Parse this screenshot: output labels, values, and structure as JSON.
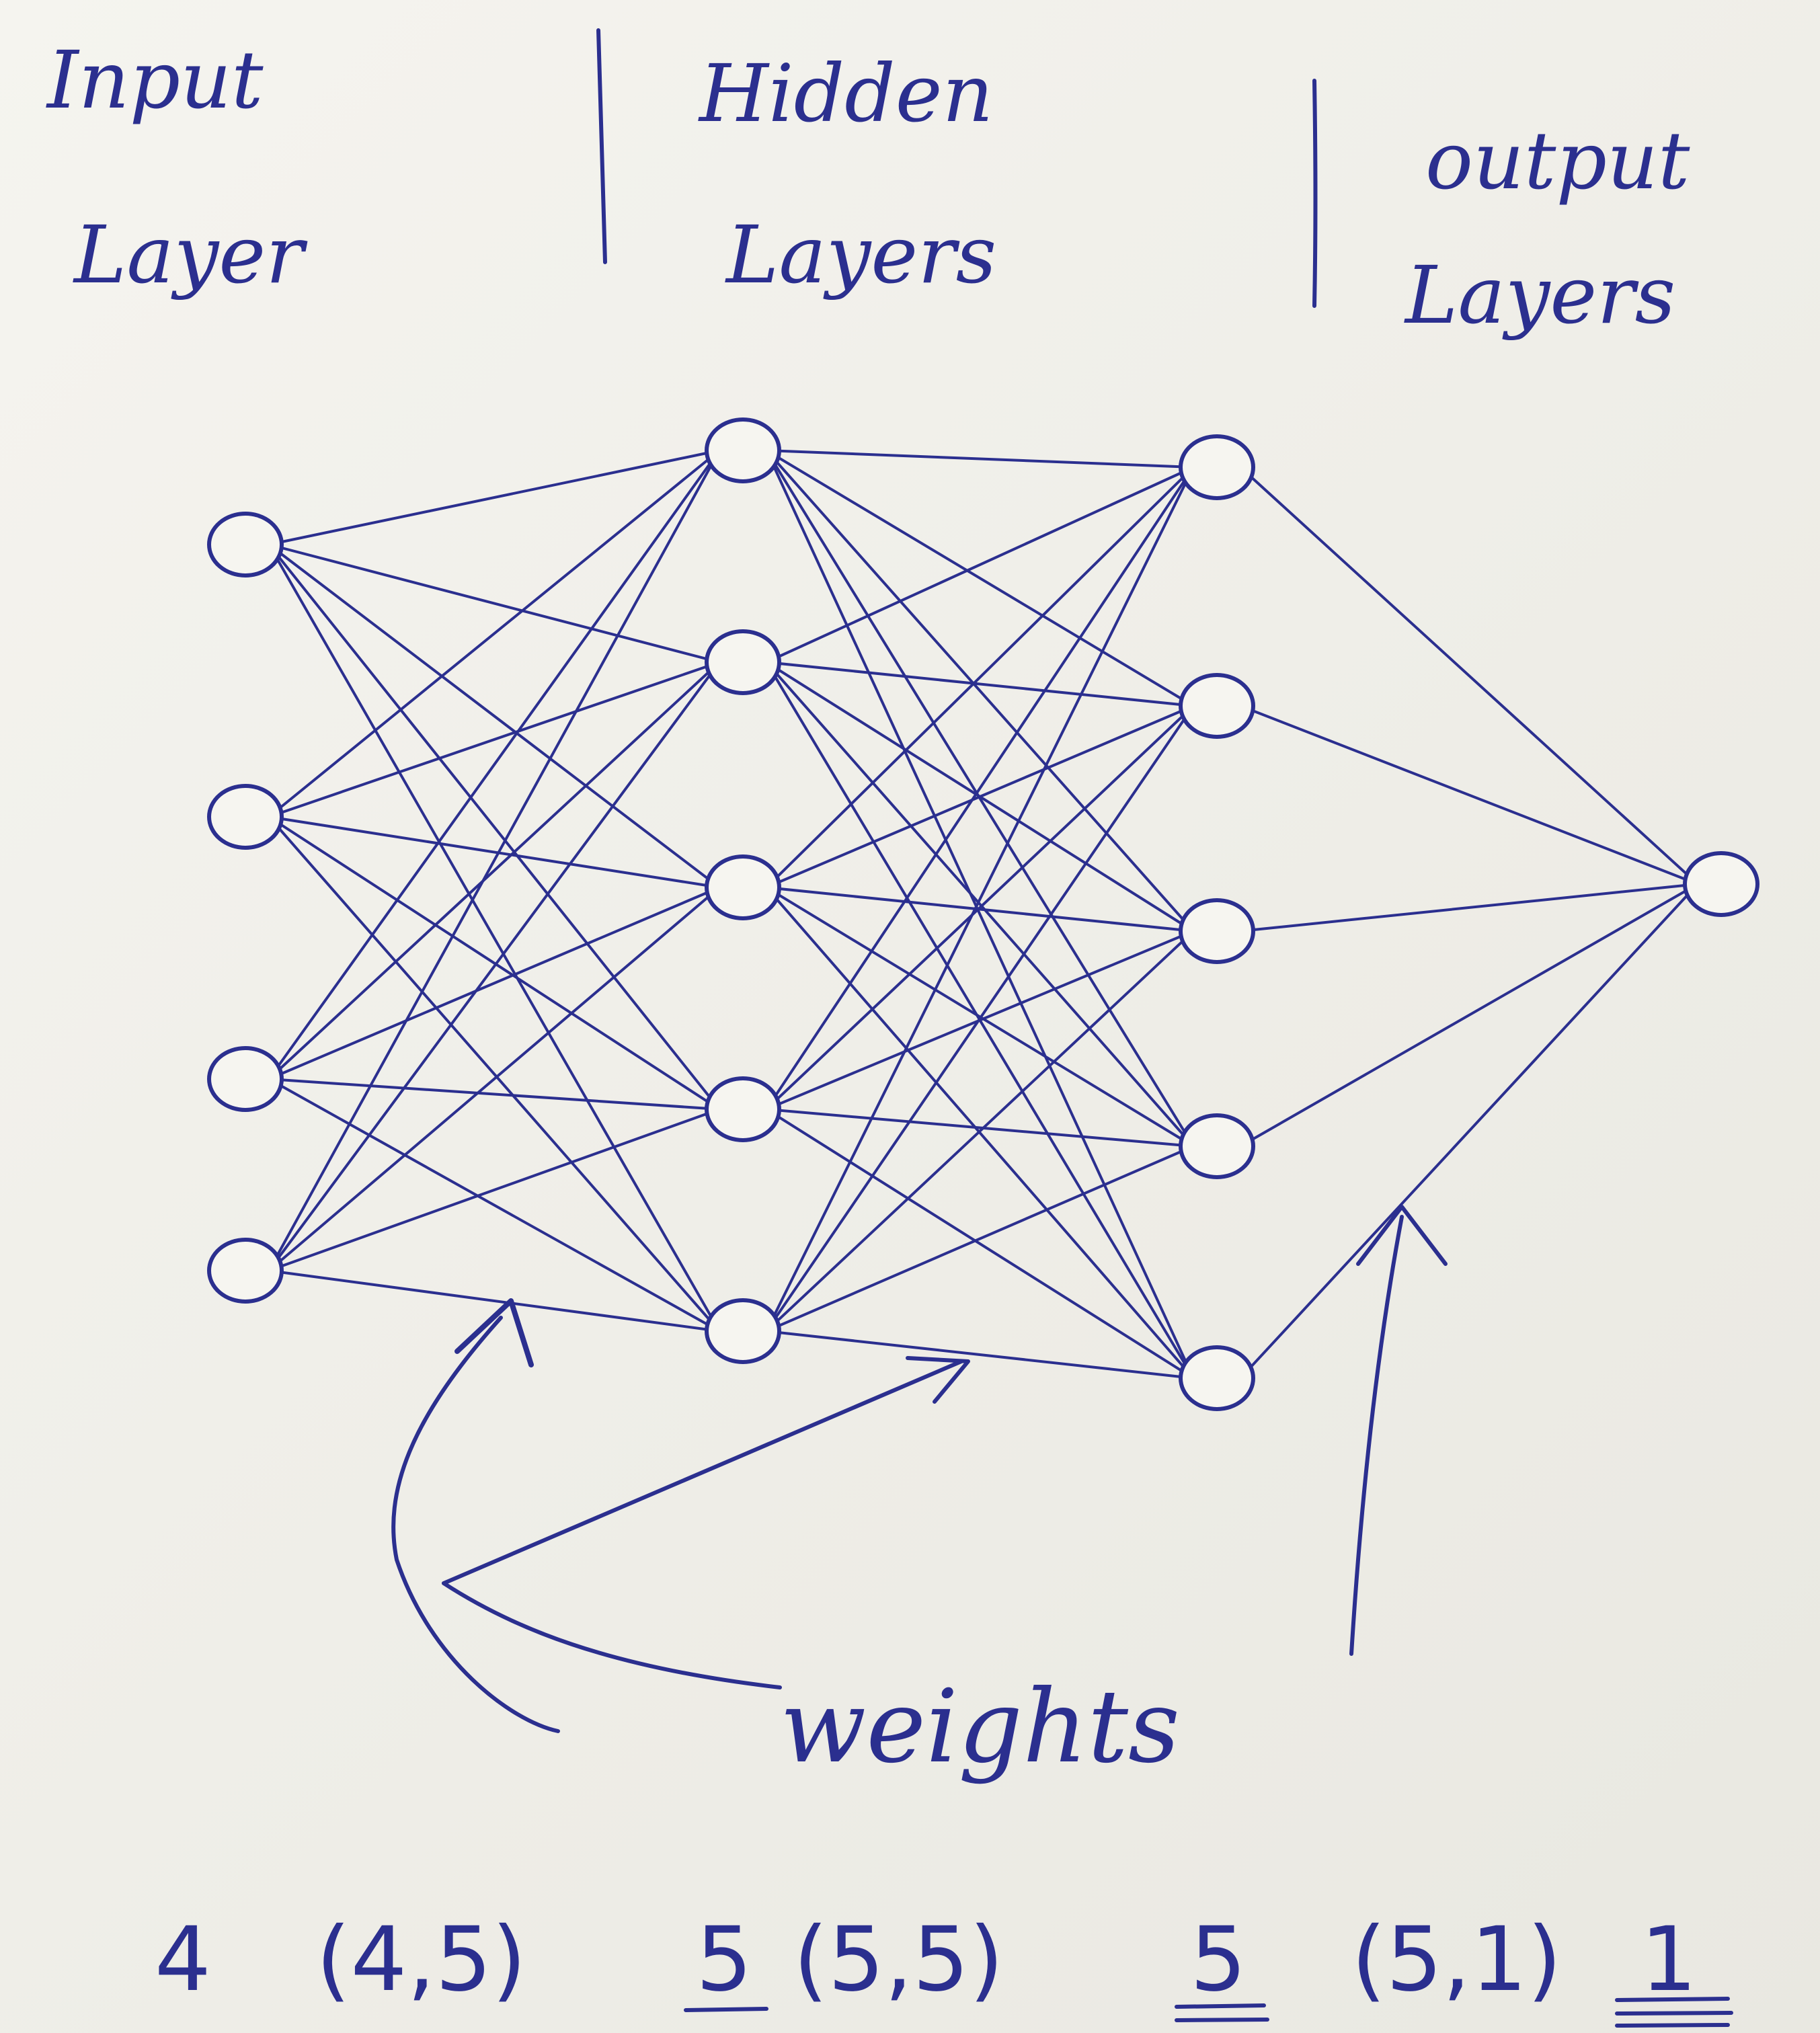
{
  "diagram": {
    "ink_color": "#2b2f8f",
    "paper_color": "#f3f2ec",
    "headers": {
      "input": [
        "Input",
        "Layer"
      ],
      "hidden": [
        "Hidden",
        "Layers"
      ],
      "output": [
        "output",
        "Layers"
      ]
    },
    "annotation": {
      "label": "weights"
    },
    "layer_sizes": [
      4,
      5,
      5,
      1
    ],
    "dimensions": {
      "input_count": "4",
      "weights_1": "(4,5)",
      "hidden_1_count": "5",
      "weights_2": "(5,5)",
      "hidden_2_count": "5",
      "weights_3": "(5,1)",
      "output_count": "1"
    }
  }
}
